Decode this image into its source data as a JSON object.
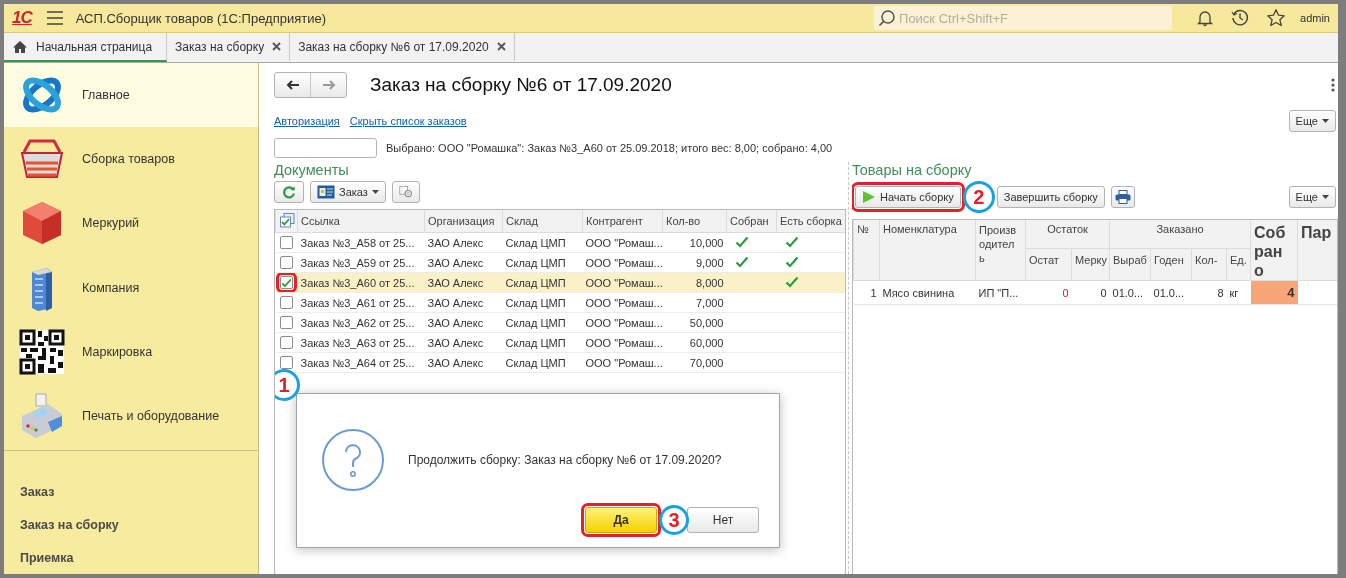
{
  "app": {
    "logo": "1С",
    "title": "АСП.Сборщик товаров  (1С:Предприятие)",
    "search": {
      "placeholder": "Поиск Ctrl+Shift+F"
    },
    "user": "admin"
  },
  "tabs": [
    {
      "label": "Начальная страница",
      "selected": true,
      "closable": false
    },
    {
      "label": "Заказ на сборку",
      "selected": false,
      "closable": true
    },
    {
      "label": "Заказ на сборку №6 от 17.09.2020",
      "selected": false,
      "closable": true
    }
  ],
  "sidebar": {
    "sections": [
      {
        "label": "Главное",
        "selected": true
      },
      {
        "label": "Сборка товаров",
        "selected": false
      },
      {
        "label": "Меркурий",
        "selected": false
      },
      {
        "label": "Компания",
        "selected": false
      },
      {
        "label": "Маркировка",
        "selected": false
      },
      {
        "label": "Печать и оборудование",
        "selected": false
      }
    ],
    "links": [
      "Заказ",
      "Заказ на сборку",
      "Приемка"
    ]
  },
  "form": {
    "title": "Заказ на сборку №6 от 17.09.2020",
    "links": [
      "Авторизация",
      "Скрыть список заказов"
    ],
    "more_button": "Еще",
    "summary": "Выбрано: ООО \"Ромашка\": Заказ №3_А60 от 25.09.2018; итого вес: 8,00; собрано: 4,00"
  },
  "documents": {
    "heading": "Документы",
    "order_button": "Заказ",
    "columns": [
      "Ссылка",
      "Организация",
      "Склад",
      "Контрагент",
      "Кол-во",
      "Собран",
      "Есть сборка"
    ],
    "rows": [
      {
        "link": "Заказ №3_А58 от 25...",
        "organization": "ЗАО Алекс",
        "warehouse": "Склад ЦМП",
        "counterparty": "ООО \"Ромаш...",
        "quantity": "10,000",
        "checked": false,
        "selected": false,
        "highlighted": false,
        "collected": true,
        "has_assembly": true
      },
      {
        "link": "Заказ №3_А59 от 25...",
        "organization": "ЗАО Алекс",
        "warehouse": "Склад ЦМП",
        "counterparty": "ООО \"Ромаш...",
        "quantity": "9,000",
        "checked": false,
        "selected": false,
        "highlighted": false,
        "collected": true,
        "has_assembly": true
      },
      {
        "link": "Заказ №3_А60 от 25...",
        "organization": "ЗАО Алекс",
        "warehouse": "Склад ЦМП",
        "counterparty": "ООО \"Ромаш...",
        "quantity": "8,000",
        "checked": true,
        "selected": true,
        "highlighted": true,
        "step": "1",
        "collected": false,
        "has_assembly": true
      },
      {
        "link": "Заказ №3_А61 от 25...",
        "organization": "ЗАО Алекс",
        "warehouse": "Склад ЦМП",
        "counterparty": "ООО \"Ромаш...",
        "quantity": "7,000",
        "checked": false,
        "selected": false,
        "highlighted": false,
        "collected": false,
        "has_assembly": false
      },
      {
        "link": "Заказ №3_А62 от 25...",
        "organization": "ЗАО Алекс",
        "warehouse": "Склад ЦМП",
        "counterparty": "ООО \"Ромаш...",
        "quantity": "50,000",
        "checked": false,
        "selected": false,
        "highlighted": false,
        "collected": false,
        "has_assembly": false
      },
      {
        "link": "Заказ №3_А63 от 25...",
        "organization": "ЗАО Алекс",
        "warehouse": "Склад ЦМП",
        "counterparty": "ООО \"Ромаш...",
        "quantity": "60,000",
        "checked": false,
        "selected": false,
        "highlighted": false,
        "collected": false,
        "has_assembly": false
      },
      {
        "link": "Заказ №3_А64 от 25...",
        "organization": "ЗАО Алекс",
        "warehouse": "Склад ЦМП",
        "counterparty": "ООО \"Ромаш...",
        "quantity": "70,000",
        "checked": false,
        "selected": false,
        "highlighted": false,
        "collected": false,
        "has_assembly": false
      }
    ]
  },
  "goods": {
    "heading": "Товары на сборку",
    "start_button": {
      "label": "Начать сборку",
      "highlighted": true,
      "step": "2"
    },
    "finish_button": "Завершить сборку",
    "more_button": "Еще",
    "columns": [
      {
        "label": "№",
        "kind": "plain"
      },
      {
        "label": "Номенклатура",
        "kind": "plain"
      },
      {
        "label": "Производитель",
        "kind": "wrap"
      },
      {
        "label": "Остаток",
        "kind": "group",
        "children": [
          "Остат",
          "Мерку"
        ]
      },
      {
        "label": "Заказано",
        "kind": "group",
        "children": [
          "Выраб",
          "Годен",
          "Кол-",
          "Ед."
        ]
      },
      {
        "label": "Собрано",
        "kind": "large"
      },
      {
        "label": "Пар",
        "kind": "large"
      }
    ],
    "rows": [
      {
        "number": "1",
        "item": "Мясо свинина",
        "producer": "ИП \"П...",
        "stock": "0",
        "stock_alert": true,
        "mercury": "0",
        "produced": "01.0...",
        "expires": "01.0...",
        "quantity": "8",
        "unit": "кг",
        "collected": "4",
        "collected_highlight": true
      }
    ]
  },
  "dialog": {
    "message": "Продолжить сборку: Заказ на сборку №6 от 17.09.2020?",
    "buttons": [
      {
        "label": "Да",
        "default": true,
        "highlighted": true,
        "step": "3"
      },
      {
        "label": "Нет",
        "default": false,
        "highlighted": false
      }
    ]
  }
}
